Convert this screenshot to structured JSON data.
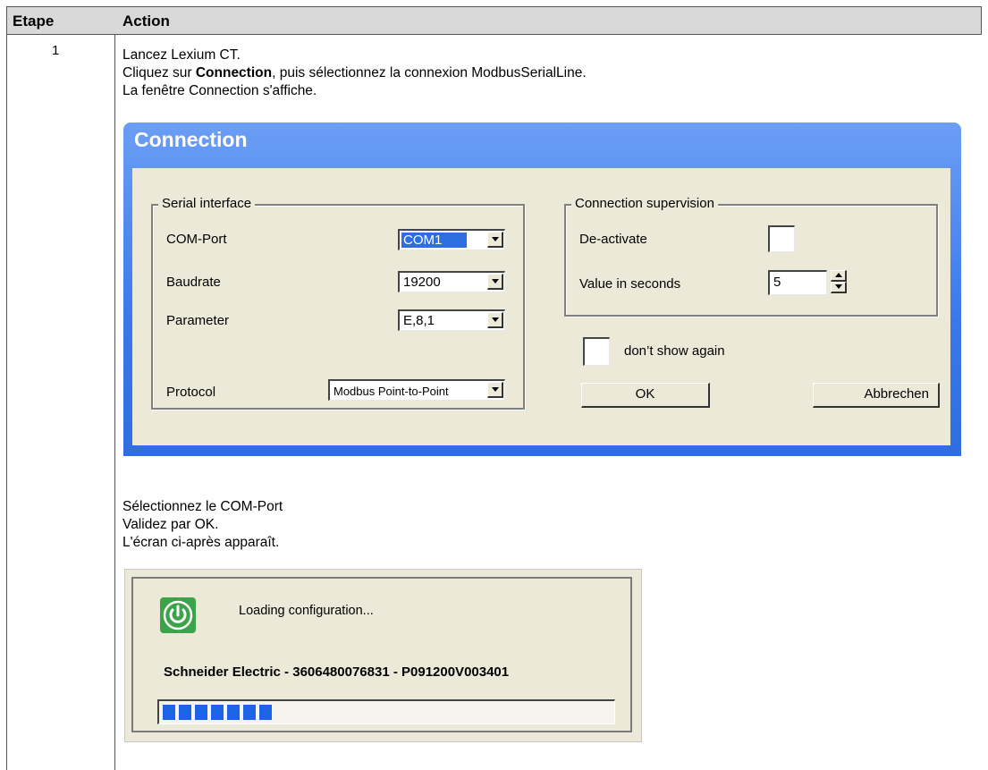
{
  "table": {
    "header_etape": "Etape",
    "header_action": "Action",
    "step_number": "1"
  },
  "instructions": {
    "line1": "Lancez Lexium CT.",
    "line2_pre": "Cliquez sur ",
    "line2_bold": "Connection",
    "line2_post": ", puis sélectionnez la connexion ModbusSerialLine.",
    "line3": "La fenêtre Connection s'affiche.",
    "line4": "Sélectionnez le COM-Port",
    "line5": "Validez par OK.",
    "line6": "L'écran ci-après apparaît."
  },
  "connection_dialog": {
    "title": "Connection",
    "serial_group": "Serial interface",
    "com_port_label": "COM-Port",
    "com_port_value": "COM1",
    "baudrate_label": "Baudrate",
    "baudrate_value": "19200",
    "parameter_label": "Parameter",
    "parameter_value": "E,8,1",
    "protocol_label": "Protocol",
    "protocol_value": "Modbus Point-to-Point",
    "supervision_group": "Connection supervision",
    "deactivate_label": "De-activate",
    "deactivate_checked": false,
    "seconds_label": "Value in seconds",
    "seconds_value": "5",
    "dont_show_label": "don’t show again",
    "dont_show_checked": false,
    "ok_label": "OK",
    "cancel_label": "Abbrechen",
    "accent_color": "#3a78ea"
  },
  "loading_window": {
    "message": "Loading configuration...",
    "device_id": "Schneider Electric - 3606480076831 - P091200V003401",
    "progress_percent": 26,
    "icon": "power-icon",
    "icon_color": "#3da34a",
    "bar_color": "#1e63e6"
  }
}
